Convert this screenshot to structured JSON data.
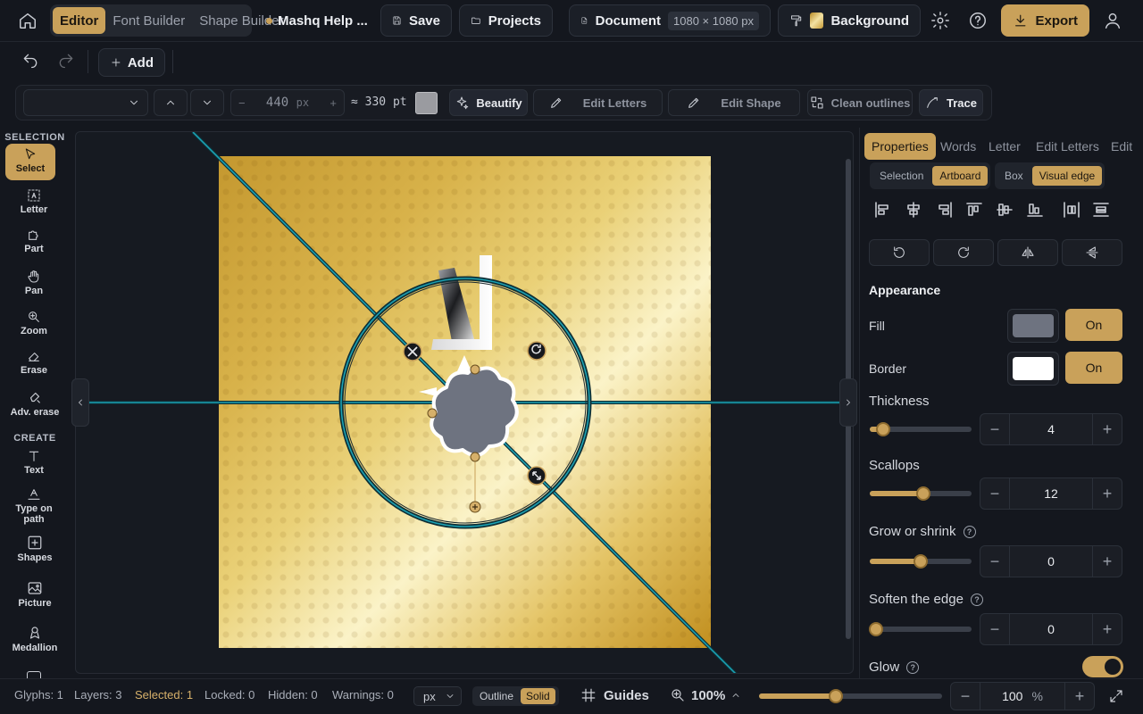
{
  "topbar": {
    "tabs": [
      "Editor",
      "Font Builder",
      "Shape Builder"
    ],
    "active_tab": "Editor",
    "help_title": "Mashq Help ...",
    "save": "Save",
    "projects": "Projects",
    "document": "Document",
    "document_size": "1080 × 1080 px",
    "background": "Background",
    "export": "Export"
  },
  "secondbar": {
    "add": "Add"
  },
  "toolbar": {
    "size_value": "440",
    "size_unit": "px",
    "pt_value": "≈ 330 pt",
    "beautify": "Beautify",
    "edit_letters": "Edit Letters",
    "edit_shape": "Edit Shape",
    "clean_outlines": "Clean outlines",
    "trace": "Trace"
  },
  "sidebar": {
    "section_selection": "SELECTION",
    "section_create": "CREATE",
    "tools": [
      {
        "label": "Select",
        "icon": "pointer-icon"
      },
      {
        "label": "Letter",
        "icon": "letter-icon"
      },
      {
        "label": "Part",
        "icon": "puzzle-icon"
      },
      {
        "label": "Pan",
        "icon": "hand-icon"
      },
      {
        "label": "Zoom",
        "icon": "zoom-icon"
      },
      {
        "label": "Erase",
        "icon": "eraser-icon"
      },
      {
        "label": "Adv. erase",
        "icon": "adv-eraser-icon"
      }
    ],
    "create_tools": [
      {
        "label": "Text",
        "icon": "text-icon"
      },
      {
        "label": "Type on path",
        "icon": "type-on-path-icon"
      },
      {
        "label": "Shapes",
        "icon": "shapes-icon"
      },
      {
        "label": "Picture",
        "icon": "picture-icon"
      },
      {
        "label": "Medallion",
        "icon": "medallion-icon"
      }
    ]
  },
  "panel": {
    "tabs": [
      "Properties",
      "Words",
      "Letter",
      "Edit Letters",
      "Edit"
    ],
    "active_tab": "Properties",
    "align_to": [
      "Selection",
      "Artboard"
    ],
    "align_to_active": "Artboard",
    "bounds": [
      "Box",
      "Visual edge"
    ],
    "bounds_active": "Visual edge",
    "appearance_heading": "Appearance",
    "fill_label": "Fill",
    "fill_color": "#6e7380",
    "fill_state": "On",
    "border_label": "Border",
    "border_color": "#ffffff",
    "border_state": "On",
    "thickness_label": "Thickness",
    "thickness_value": "4",
    "thickness_fraction": 0.13,
    "scallops_label": "Scallops",
    "scallops_value": "12",
    "scallops_fraction": 0.53,
    "grow_label": "Grow or shrink",
    "grow_value": "0",
    "grow_fraction": 0.5,
    "soften_label": "Soften the edge",
    "soften_value": "0",
    "soften_fraction": 0.06,
    "glow_label": "Glow",
    "glow_on": true
  },
  "status": {
    "glyphs": "Glyphs: 1",
    "layers": "Layers: 3",
    "selected": "Selected: 1",
    "locked": "Locked: 0",
    "hidden": "Hidden: 0",
    "warnings": "Warnings: 0",
    "unit": "px",
    "outline": "Outline",
    "solid": "Solid",
    "guides": "Guides",
    "zoom_percent": "100%",
    "zoom_fraction": 0.42,
    "zoom_value": "100",
    "zoom_unit": "%"
  },
  "colors": {
    "accent": "#c9a15a",
    "guide": "#1b8a9a",
    "bg": "#14171e"
  }
}
